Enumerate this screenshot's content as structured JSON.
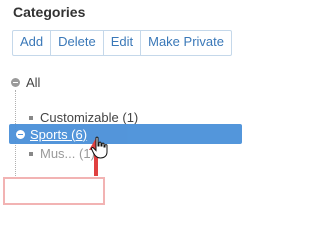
{
  "panel": {
    "title": "Categories"
  },
  "toolbar": {
    "add_label": "Add",
    "delete_label": "Delete",
    "edit_label": "Edit",
    "make_private_label": "Make Private"
  },
  "tree": {
    "root": {
      "label": "All",
      "state": "expanded",
      "icon": "minus-icon"
    },
    "children": [
      {
        "label": "Customizable (1)"
      },
      {
        "label": "Mus... (1)"
      }
    ],
    "dragging": {
      "label": "Sports (6)",
      "color": "#4a90d9"
    }
  },
  "colors": {
    "accent": "#3a78b8",
    "highlight": "#4a90d9",
    "annotation_arrow": "#e04040",
    "drop_box": "#f2b3b3"
  }
}
